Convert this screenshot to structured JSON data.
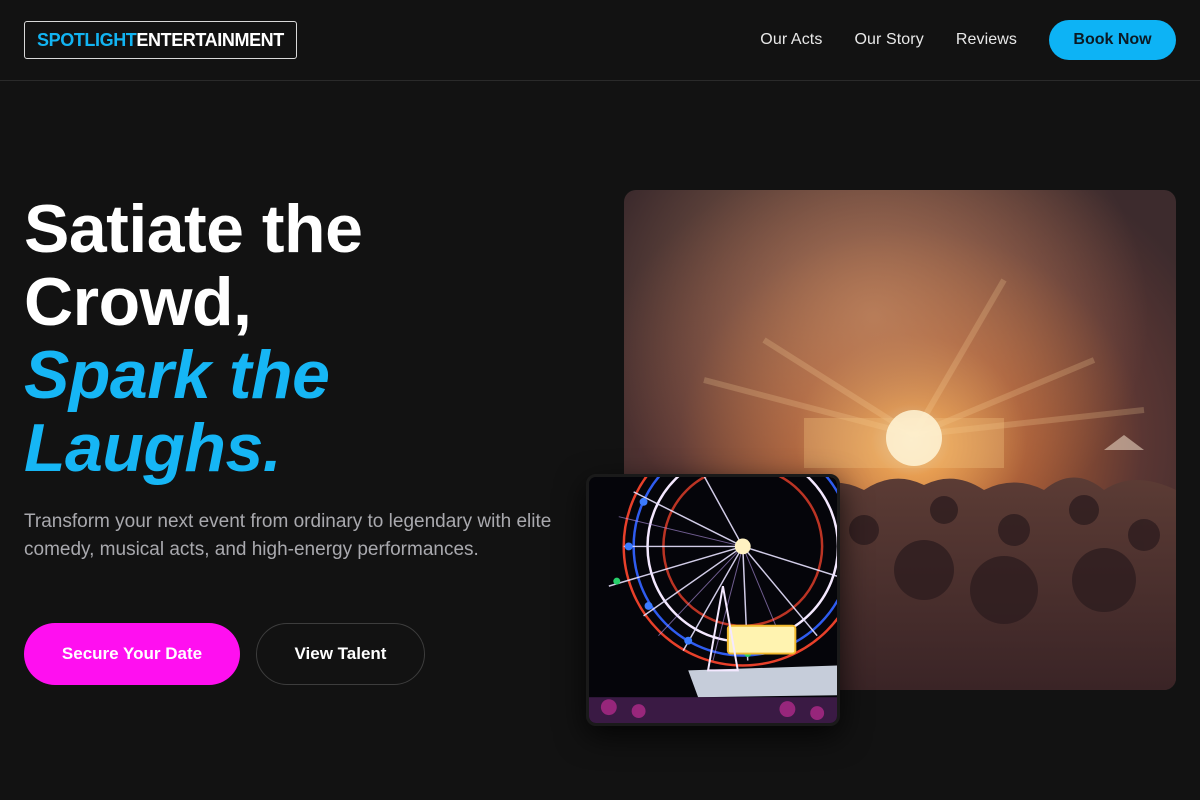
{
  "brand": {
    "part1": "SPOTLIGHT",
    "part2": " ENTERTAINMENT"
  },
  "nav": {
    "links": [
      "Our Acts",
      "Our Story",
      "Reviews"
    ],
    "book_label": "Book Now"
  },
  "hero": {
    "title_lines": [
      "Satiate the",
      "Crowd,"
    ],
    "accent_lines": [
      "Spark the",
      "Laughs."
    ],
    "subtitle": "Transform your next event from ordinary to legendary with elite comedy, musical acts, and high-energy performances.",
    "primary_cta": "Secure Your Date",
    "secondary_cta": "View Talent"
  },
  "images": {
    "main": "concert-crowd-photo",
    "inset": "ferris-wheel-photo"
  },
  "colors": {
    "background": "#121212",
    "accent_blue": "#16b6f5",
    "accent_magenta": "#ff0ff0",
    "text_muted": "#a9a9ae"
  }
}
